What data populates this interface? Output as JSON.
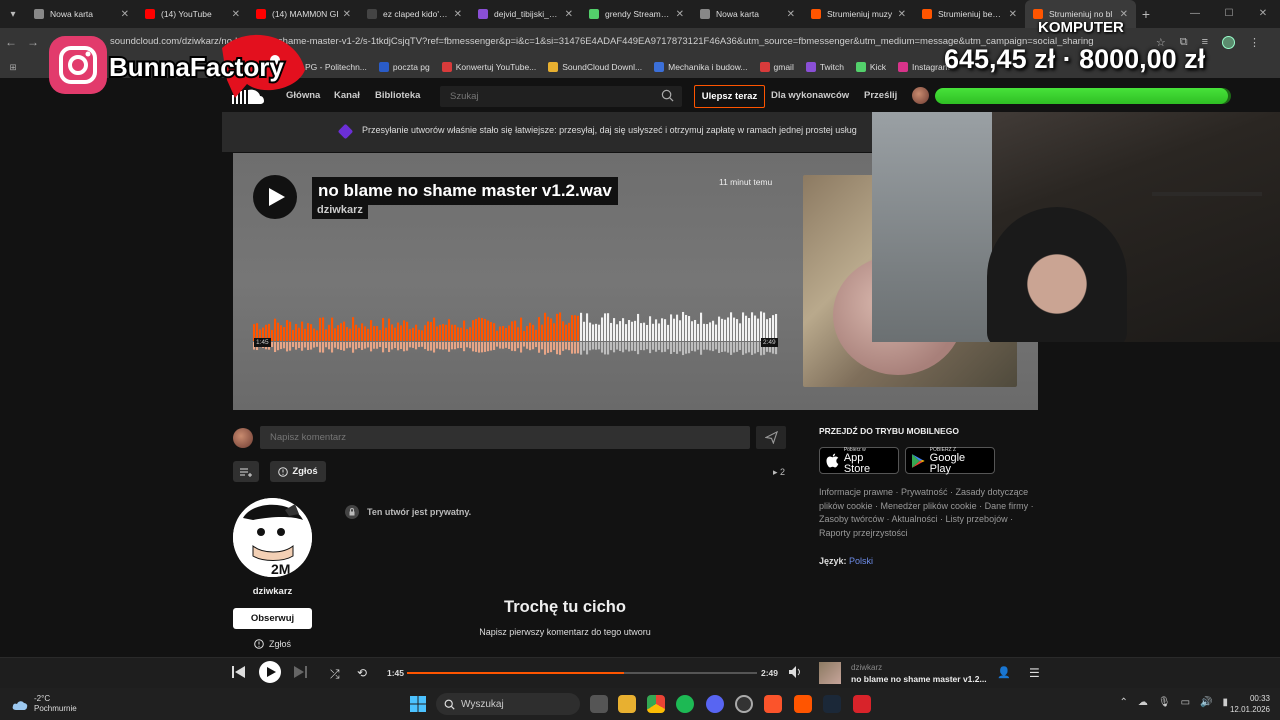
{
  "tabs": [
    {
      "label": "Nowa karta",
      "color": "#888888"
    },
    {
      "label": "(14) YouTube",
      "color": "#ff0000"
    },
    {
      "label": "(14) MAMM0N GI",
      "color": "#ff0000"
    },
    {
      "label": "ez claped kido's F",
      "color": "#444444"
    },
    {
      "label": "dejvid_tibijski_zac",
      "color": "#8a4fd6"
    },
    {
      "label": "grendy Stream - V",
      "color": "#53d06b"
    },
    {
      "label": "Nowa karta",
      "color": "#888888"
    },
    {
      "label": "Strumieniuj muzy",
      "color": "#ff5500"
    },
    {
      "label": "Strumieniuj bez w",
      "color": "#ff5500"
    },
    {
      "label": "Strumieniuj no bl",
      "color": "#ff5500"
    }
  ],
  "url": "soundcloud.com/dziwkarz/no-blame-no-shame-master-v1-2/s-1tkdjCsjqTV?ref=fbmessenger&p=i&c=1&si=31476E4ADAF449EA9717873121F46A36&utm_source=fbmessenger&utm_medium=message&utm_campaign=social_sharing",
  "bookmarks": [
    {
      "label": "PG - Politechn...",
      "color": "#2a5cc8"
    },
    {
      "label": "poczta pg",
      "color": "#2a5cc8"
    },
    {
      "label": "Konwertuj YouTube...",
      "color": "#d83b3b"
    },
    {
      "label": "SoundCloud Downl...",
      "color": "#e8b030"
    },
    {
      "label": "Mechanika i budow...",
      "color": "#3b6fd8"
    },
    {
      "label": "gmail",
      "color": "#d83b3b"
    },
    {
      "label": "Twitch",
      "color": "#8a4fd6"
    },
    {
      "label": "Kick",
      "color": "#53d06b"
    },
    {
      "label": "Instagram",
      "color": "#d8338a"
    }
  ],
  "sc_nav": {
    "home": "Główna",
    "feed": "Kanał",
    "library": "Biblioteka",
    "search_placeholder": "Szukaj",
    "upgrade": "Ulepsz teraz",
    "for_artists": "Dla wykonawców",
    "upload": "Prześlij"
  },
  "banner_text": "Przesyłanie utworów właśnie stało się łatwiejsze: przesyłaj, daj się usłyszeć i otrzymuj zapłatę w ramach jednej prostej usług",
  "track": {
    "title": "no blame no shame master v1.2.wav",
    "artist": "dziwkarz",
    "posted": "11 minut temu",
    "current_time": "1:45",
    "duration": "2:49",
    "progress": 0.62
  },
  "comment": {
    "placeholder": "Napisz komentarz",
    "report": "Zgłoś",
    "reposts": "2"
  },
  "artist_panel": {
    "name": "dziwkarz",
    "follow": "Obserwuj",
    "report": "Zgłoś"
  },
  "private_notice": "Ten utwór jest prywatny.",
  "empty_comments": {
    "title": "Trochę tu cicho",
    "subtitle": "Napisz pierwszy komentarz do tego utworu"
  },
  "sidebar": {
    "mobile_heading": "PRZEJDŹ DO TRYBU MOBILNEGO",
    "app_store_small": "Pobierz w",
    "app_store": "App Store",
    "google_small": "POBIERZ Z",
    "google_play": "Google Play",
    "footer_links": "Informacje prawne · Prywatność · Zasady dotyczące plików cookie · Menedżer plików cookie · Dane firmy · Zasoby twórców · Aktualności · Listy przebojów · Raporty przejrzystości",
    "language_label": "Język:",
    "language_value": "Polski"
  },
  "overlay": {
    "goal_label": "KOMPUTER",
    "goal_amount": "645,45 zł · 8000,00 zł",
    "goal_progress": 0.99,
    "brand": "BunnaFactory"
  },
  "player": {
    "current": "1:45",
    "duration": "2:49",
    "artist": "dziwkarz",
    "title": "no blame no shame master v1.2..."
  },
  "taskbar": {
    "temp": "-2°C",
    "weather": "Pochmurnie",
    "search": "Wyszukaj",
    "time": "00:33",
    "date": "12.01.2026"
  },
  "colors": {
    "accent": "#ff5500",
    "goal_green": "#3fd630"
  }
}
